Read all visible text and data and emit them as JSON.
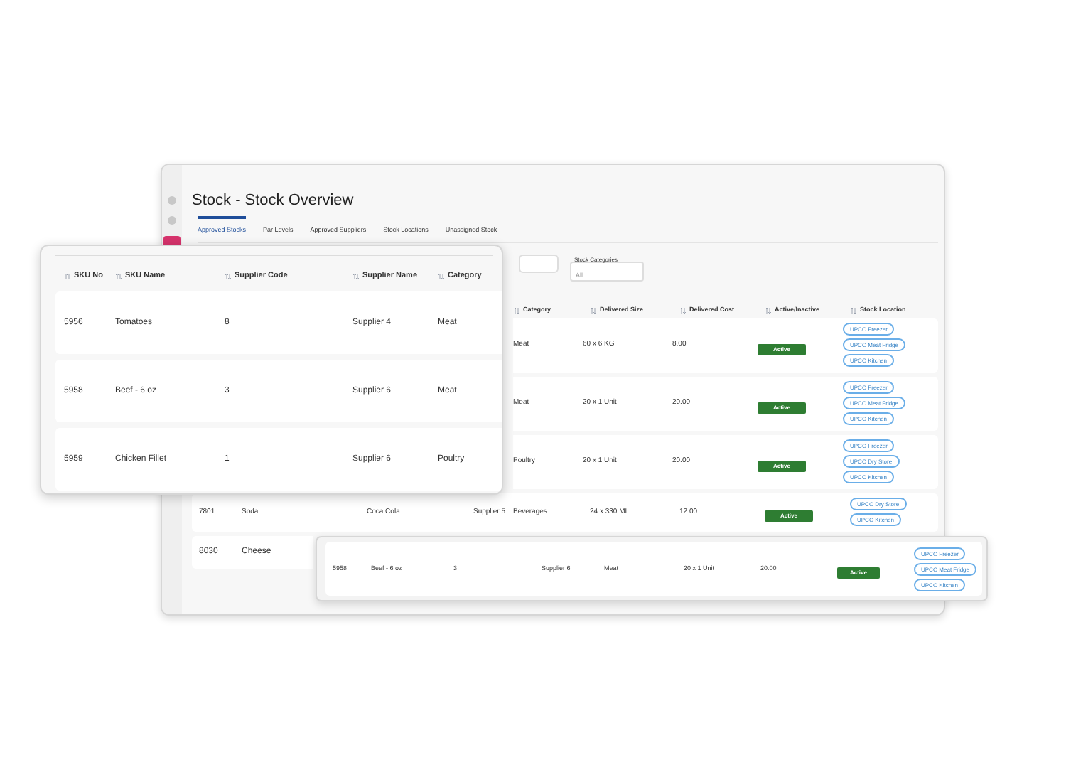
{
  "sidebar": {
    "items": [
      {
        "selected": false
      },
      {
        "selected": false
      },
      {
        "selected": true
      }
    ]
  },
  "title": "Stock - Stock Overview",
  "tabs": [
    {
      "label": "Approved Stocks",
      "selected": true
    },
    {
      "label": "Par Levels",
      "selected": false
    },
    {
      "label": "Approved Suppliers",
      "selected": false
    },
    {
      "label": "Stock Locations",
      "selected": false
    },
    {
      "label": "Unassigned Stock",
      "selected": false
    }
  ],
  "filters": [
    {
      "label": "Stock Categories",
      "placeholder": "All"
    }
  ],
  "table": {
    "columns": [
      {
        "kind": "category",
        "label": "Category"
      },
      {
        "kind": "delivered_size",
        "label": "Delivered Size"
      },
      {
        "kind": "delivered_cost",
        "label": "Delivered Cost"
      },
      {
        "kind": "status",
        "label": "Active/Inactive"
      },
      {
        "kind": "locations",
        "label": "Stock Location"
      }
    ],
    "rows": [
      {
        "category": "Meat",
        "delivered_size": "60 x 6 KG",
        "delivered_cost": "8.00",
        "status": {
          "label": "Active",
          "active": true
        },
        "locations": [
          "UPCO Freezer",
          "UPCO Meat Fridge",
          "UPCO Kitchen"
        ]
      },
      {
        "category": "Meat",
        "delivered_size": "20 x 1 Unit",
        "delivered_cost": "20.00",
        "status": {
          "label": "Active",
          "active": true
        },
        "locations": [
          "UPCO Freezer",
          "UPCO Meat Fridge",
          "UPCO Kitchen"
        ]
      },
      {
        "category": "Poultry",
        "delivered_size": "20 x 1 Unit",
        "delivered_cost": "20.00",
        "status": {
          "label": "Active",
          "active": true
        },
        "locations": [
          "UPCO Freezer",
          "UPCO Dry Store",
          "UPCO Kitchen"
        ]
      },
      {
        "sku": "7801",
        "name": "Soda",
        "supplier_code": "Coca Cola",
        "supplier_name": "Supplier 5",
        "category": "Beverages",
        "delivered_size": "24 x 330 ML",
        "delivered_cost": "12.00",
        "status": {
          "label": "Active",
          "active": true
        },
        "locations": [
          "UPCO Dry Store",
          "UPCO Kitchen"
        ]
      },
      {
        "sku": "8030",
        "name": "Cheese"
      }
    ]
  },
  "zoom_table": {
    "columns": [
      {
        "kind": "sku",
        "label": "SKU No"
      },
      {
        "kind": "name",
        "label": "SKU Name"
      },
      {
        "kind": "supplier_code",
        "label": "Supplier Code"
      },
      {
        "kind": "supplier_name",
        "label": "Supplier Name"
      },
      {
        "kind": "category",
        "label": "Category"
      }
    ],
    "rows": [
      {
        "sku": "5956",
        "name": "Tomatoes",
        "supplier_code": "8",
        "supplier_name": "Supplier 4",
        "category": "Meat"
      },
      {
        "sku": "5958",
        "name": "Beef - 6 oz",
        "supplier_code": "3",
        "supplier_name": "Supplier 6",
        "category": "Meat"
      },
      {
        "sku": "5959",
        "name": "Chicken Fillet",
        "supplier_code": "1",
        "supplier_name": "Supplier 6",
        "category": "Poultry"
      }
    ]
  },
  "highlight_row": {
    "sku": "5958",
    "name": "Beef - 6 oz",
    "supplier_code": "3",
    "supplier_name": "Supplier 6",
    "category": "Meat",
    "delivered_size": "20 x 1 Unit",
    "delivered_cost": "20.00",
    "status": {
      "label": "Active",
      "active": true
    },
    "locations": [
      "UPCO Freezer",
      "UPCO Meat Fridge",
      "UPCO Kitchen"
    ]
  }
}
